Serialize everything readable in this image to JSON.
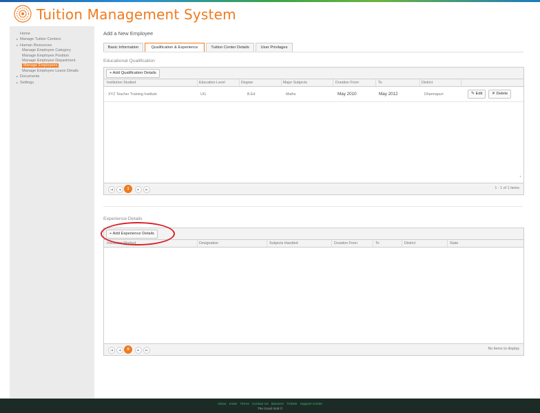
{
  "app": {
    "title": "Tuition Management System",
    "logo_icon": "gear-emblem-icon",
    "accent_color": "#f07a1e"
  },
  "sidebar": {
    "items": [
      {
        "label": "Home",
        "level": 0,
        "arrow": ""
      },
      {
        "label": "Manage Tuition Centers",
        "level": 0,
        "arrow": "▸"
      },
      {
        "label": "Human Resources",
        "level": 0,
        "arrow": "▾"
      },
      {
        "label": "Manage Employee Category",
        "level": 1
      },
      {
        "label": "Manage Employee Position",
        "level": 1
      },
      {
        "label": "Manage Employee Department",
        "level": 1
      },
      {
        "label": "Manage Employees",
        "level": 1,
        "active": true
      },
      {
        "label": "Manage Employee Leave Details",
        "level": 1
      },
      {
        "label": "Documents",
        "level": 0,
        "arrow": "▸"
      },
      {
        "label": "Settings",
        "level": 0,
        "arrow": "▸"
      }
    ]
  },
  "page": {
    "title": "Add a New Employee",
    "tabs": [
      {
        "label": "Basic Information"
      },
      {
        "label": "Qualification & Experience",
        "active": true
      },
      {
        "label": "Tuition Center Details"
      },
      {
        "label": "User Privilages"
      }
    ]
  },
  "qualification": {
    "section_title": "Educational Qualification",
    "add_button": "+ Add Qualification Details",
    "columns": [
      "Institution Studied",
      "Education Level",
      "Degree",
      "Major Subjects",
      "Duration From",
      "To",
      "District"
    ],
    "rows": [
      {
        "institution": "XYZ Teacher Training Institute",
        "level": "UG",
        "degree": "B.Ed",
        "subjects": "Maths",
        "from": "May 2010",
        "to": "May 2012",
        "district": "Dharmapuri"
      }
    ],
    "edit_label": "✎ Edit",
    "delete_label": "✕ Delete",
    "pager": {
      "current_page": "1",
      "info": "1 - 1 of 1 items"
    }
  },
  "experience": {
    "section_title": "Experience Details",
    "add_button": "+ Add Experience Details",
    "columns": [
      "Institution Worked",
      "Designation",
      "Subjects Handled",
      "Duration From",
      "To",
      "District",
      "State"
    ],
    "pager": {
      "current_page": "0",
      "info": "No items to display"
    }
  },
  "footer": {
    "links": [
      "About",
      "Invite",
      "Terms",
      "Contact Us",
      "Banners",
      "Tickets",
      "Support Center"
    ],
    "copyright": "The Good Grid ©"
  }
}
